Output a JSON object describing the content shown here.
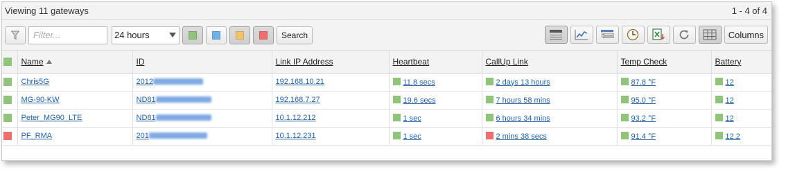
{
  "colors": {
    "ok": "#8fc47a",
    "info": "#6fb0e6",
    "warning": "#f2c36b",
    "error": "#ee6e6e",
    "link": "#1f5fa8"
  },
  "header": {
    "title": "Viewing 11 gateways",
    "paging": "1 - 4 of 4"
  },
  "toolbar": {
    "filter_icon": "funnel-icon",
    "filter_placeholder": "Filter...",
    "time_range": "24 hours",
    "status_filters": [
      "ok",
      "info",
      "warning",
      "error"
    ],
    "search_label": "Search",
    "tools": [
      "list-view-icon",
      "chart-icon",
      "tree-view-icon",
      "clock-icon",
      "excel-export-icon",
      "refresh-icon",
      "grid-view-icon"
    ],
    "columns_label": "Columns"
  },
  "table": {
    "columns": [
      "Name",
      "ID",
      "Link IP Address",
      "Heartbeat",
      "CallUp Link",
      "Temp Check",
      "Battery"
    ],
    "rows": [
      {
        "status": "ok",
        "name": "Chris5G",
        "id": "2012",
        "ip": "192.168.10.21",
        "heartbeat": "11.8 secs",
        "heartbeat_status": "ok",
        "callup": "2 days 13 hours",
        "callup_status": "ok",
        "temp": "87.8 °F",
        "temp_status": "ok",
        "battery": "12",
        "battery_status": "ok"
      },
      {
        "status": "ok",
        "name": "MG-90-KW",
        "id": "ND81",
        "ip": "192.168.7.27",
        "heartbeat": "19.6 secs",
        "heartbeat_status": "ok",
        "callup": "7 hours 58 mins",
        "callup_status": "ok",
        "temp": "95.0 °F",
        "temp_status": "ok",
        "battery": "12",
        "battery_status": "ok"
      },
      {
        "status": "ok",
        "name": "Peter_MG90_LTE",
        "id": "ND81",
        "ip": "10.1.12.212",
        "heartbeat": "1 sec",
        "heartbeat_status": "ok",
        "callup": "6 hours 34 mins",
        "callup_status": "ok",
        "temp": "93.2 °F",
        "temp_status": "ok",
        "battery": "12",
        "battery_status": "ok"
      },
      {
        "status": "error",
        "name": "PF_RMA",
        "id": "201",
        "ip": "10.1.12.231",
        "heartbeat": "1 sec",
        "heartbeat_status": "ok",
        "callup": "2 mins 38 secs",
        "callup_status": "error",
        "temp": "91.4 °F",
        "temp_status": "ok",
        "battery": "12.2",
        "battery_status": "ok"
      }
    ]
  }
}
